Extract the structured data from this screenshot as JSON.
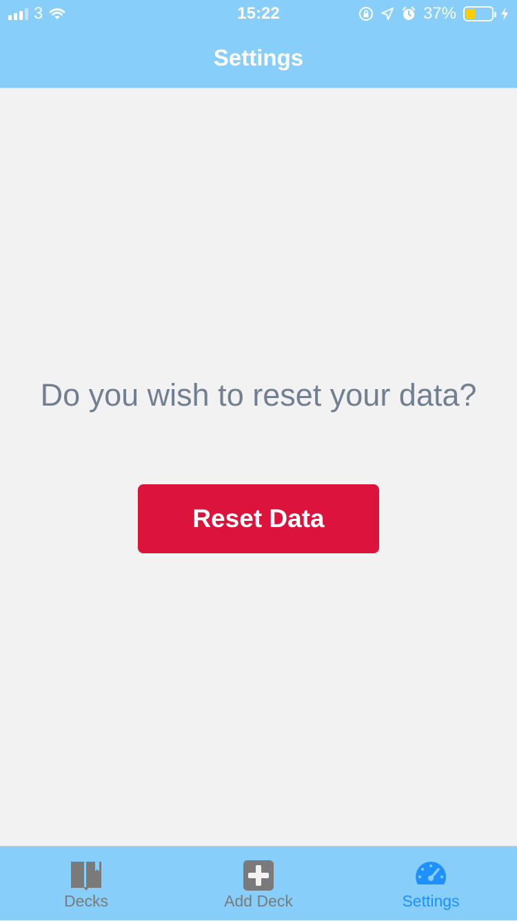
{
  "status_bar": {
    "carrier": "3",
    "time": "15:22",
    "battery_percent": "37%",
    "battery_level": 0.37,
    "battery_color": "#ffcc00"
  },
  "header": {
    "title": "Settings",
    "background": "#87cefa"
  },
  "main": {
    "prompt": "Do you wish to reset your data?",
    "reset_button_label": "Reset Data",
    "reset_button_color": "#dc143c"
  },
  "tab_bar": {
    "active_color": "#1e90ff",
    "inactive_color": "#7a7a7a",
    "tabs": [
      {
        "label": "Decks",
        "icon": "book-icon",
        "active": false
      },
      {
        "label": "Add Deck",
        "icon": "plus-square-icon",
        "active": false
      },
      {
        "label": "Settings",
        "icon": "speedometer-icon",
        "active": true
      }
    ]
  }
}
